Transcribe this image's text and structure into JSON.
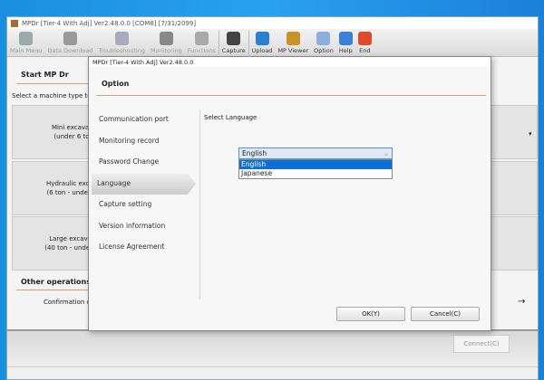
{
  "window": {
    "title": "MPDr [Tier-4 With Adj] Ver2.48.0.0 [COM8] [7/31/2099]"
  },
  "toolbar": [
    {
      "label": "Main Menu",
      "icon": "main-menu-icon",
      "enabled": false,
      "color": "#9aa"
    },
    {
      "label": "Data Download",
      "icon": "download-icon",
      "enabled": false,
      "color": "#999"
    },
    {
      "label": "Troubleshooting",
      "icon": "stethoscope-icon",
      "enabled": false,
      "color": "#aab"
    },
    {
      "label": "Monitoring",
      "icon": "gauge-icon",
      "enabled": false,
      "color": "#888"
    },
    {
      "label": "Functions",
      "icon": "functions-icon",
      "enabled": false,
      "color": "#aaa"
    },
    {
      "label": "Capture",
      "icon": "camera-icon",
      "enabled": true,
      "color": "#444"
    },
    {
      "label": "Upload",
      "icon": "upload-icon",
      "enabled": true,
      "color": "#2a7fd0"
    },
    {
      "label": "MP Viewer",
      "icon": "viewer-icon",
      "enabled": true,
      "color": "#c9912a"
    },
    {
      "label": "Option",
      "icon": "gear-icon",
      "enabled": true,
      "color": "#8ab0e0"
    },
    {
      "label": "Help",
      "icon": "help-icon",
      "enabled": true,
      "color": "#3a7fd8"
    },
    {
      "label": "End",
      "icon": "power-icon",
      "enabled": true,
      "color": "#e04a2a"
    }
  ],
  "main": {
    "start_title": "Start MP Dr",
    "select_text": "Select a machine type to",
    "machines": [
      {
        "l1": "Mini excavat",
        "l2": "(under 6 to"
      },
      {
        "l1": "Hydraulic excav",
        "l2": "(6 ton - under 4"
      },
      {
        "l1": "Large excavat",
        "l2": "(40 ton - under 1"
      }
    ],
    "other_title": "Other operations",
    "confirmation": "Confirmation o",
    "connect": "Connect(C)"
  },
  "dialog": {
    "title": "MPDr [Tier-4 With Adj] Ver2.48.0.0",
    "header": "Option",
    "nav": [
      "Communication port",
      "Monitoring record",
      "Password Change",
      "Language",
      "Capture setting",
      "Version information",
      "License Agreement"
    ],
    "active": "Language",
    "select_label": "Select Language",
    "selected": "English",
    "options": [
      "English",
      "Japanese"
    ],
    "ok": "OK(Y)",
    "cancel": "Cancel(C)"
  }
}
